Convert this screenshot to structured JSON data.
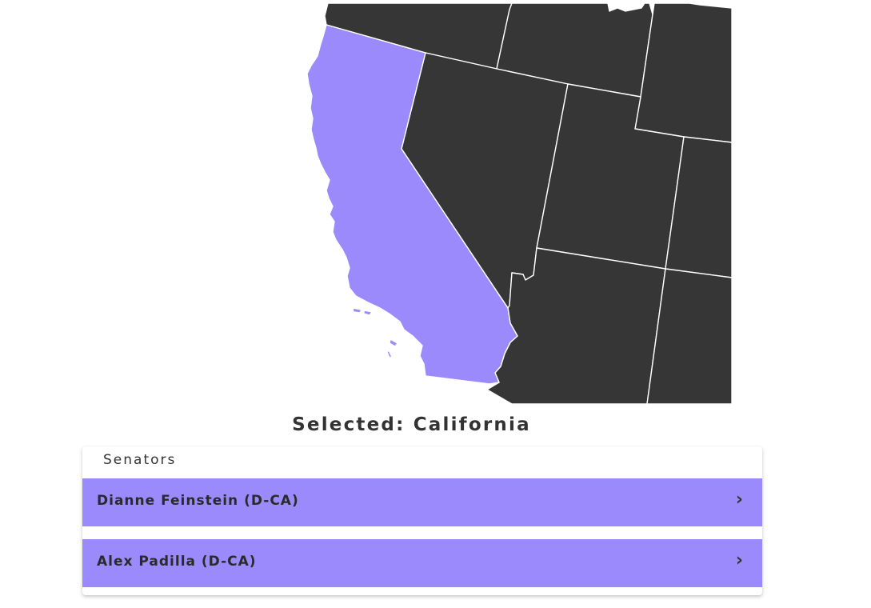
{
  "map": {
    "selected_state": "California",
    "selected_color": "#9b8afb",
    "other_state_color": "#363636",
    "border_color": "#ffffff",
    "visible_states": [
      "California",
      "Oregon",
      "Idaho",
      "Wyoming",
      "Nevada",
      "Utah",
      "Colorado",
      "Arizona",
      "New Mexico"
    ]
  },
  "selection": {
    "label": "Selected:",
    "state": "California"
  },
  "panel": {
    "heading": "Senators",
    "senators": [
      {
        "name": "Dianne Feinstein (D-CA)",
        "chevron": "›"
      },
      {
        "name": "Alex Padilla (D-CA)",
        "chevron": "›"
      }
    ]
  }
}
